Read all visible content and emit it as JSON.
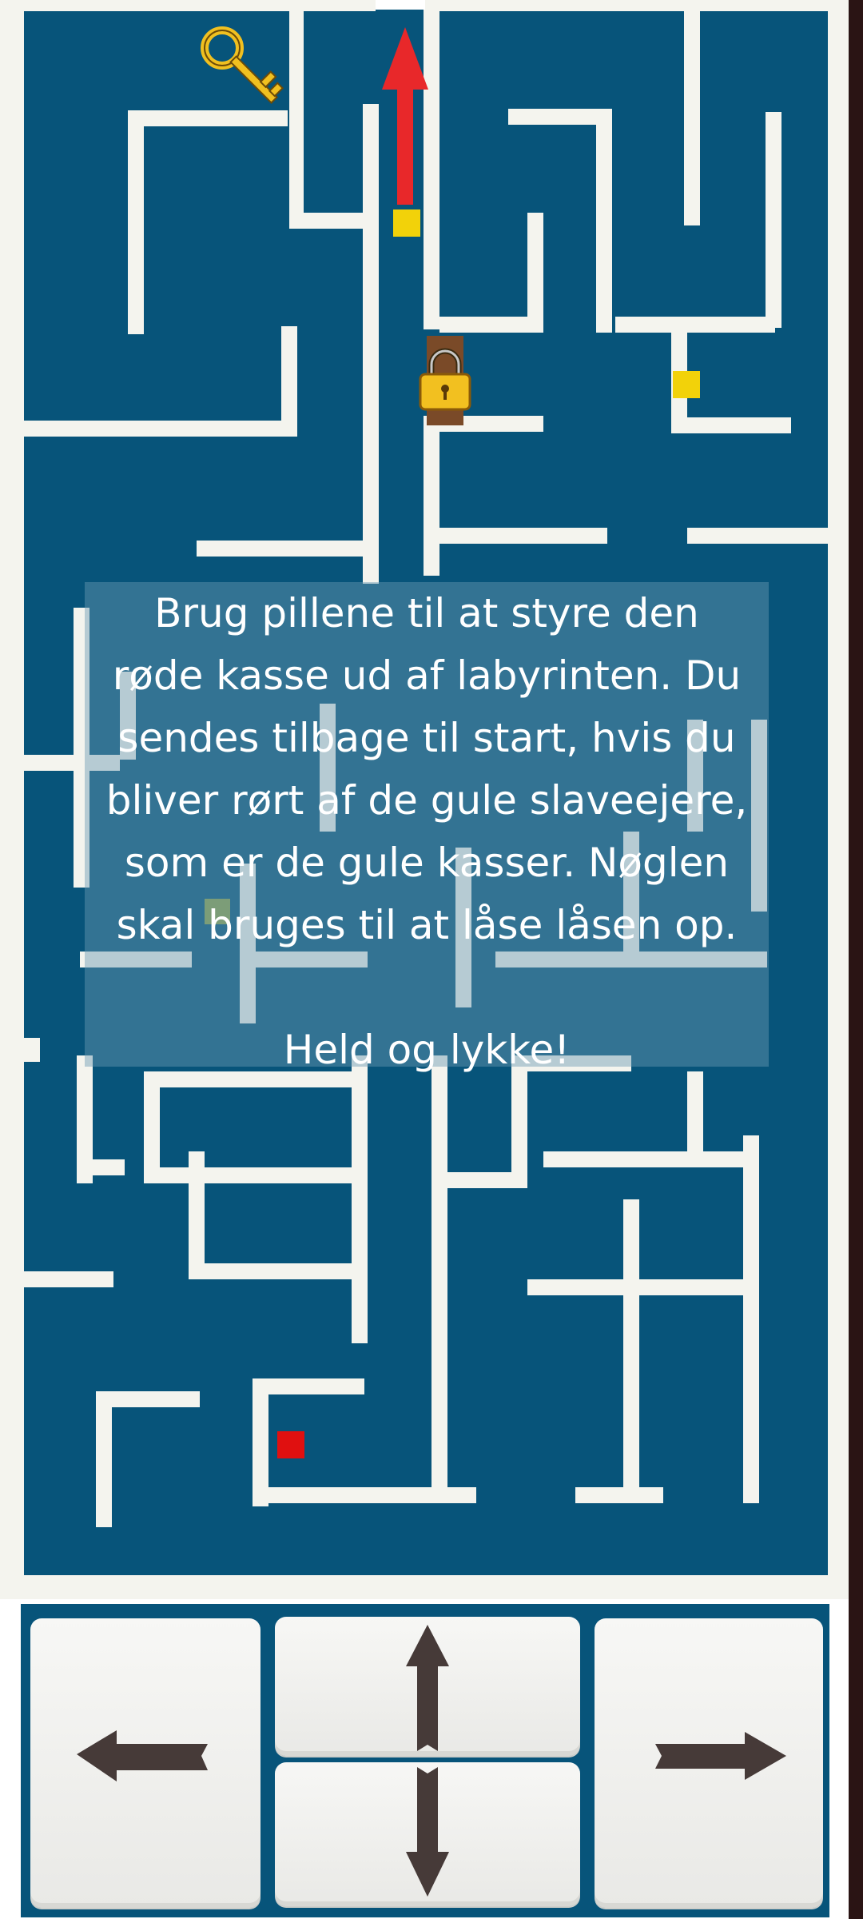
{
  "instructions": {
    "lines": [
      "Brug pillene til at styre den",
      "røde kasse ud af labyrinten. Du",
      "sendes tilbage til start, hvis du",
      "bliver rørt af de gule slaveejere,",
      "som er de gule kasser. Nøglen",
      "skal bruges til at låse låsen op."
    ],
    "farewell": "Held og lykke!"
  },
  "colors": {
    "maze_background": "#07547a",
    "wall": "#f4f4ee",
    "player": "#e01010",
    "enemy": "#f2d20a",
    "exit_arrow": "#e8282a",
    "key": "#f0c020",
    "lock_door": "#7a4a28",
    "button_face": "#f2f2f0",
    "arrow_glyph": "#463a38"
  },
  "icons": {
    "key": "key-icon",
    "lock": "padlock-icon",
    "exit": "exit-arrow-icon",
    "left": "arrow-left-icon",
    "up": "arrow-up-icon",
    "down": "arrow-down-icon",
    "right": "arrow-right-icon"
  }
}
